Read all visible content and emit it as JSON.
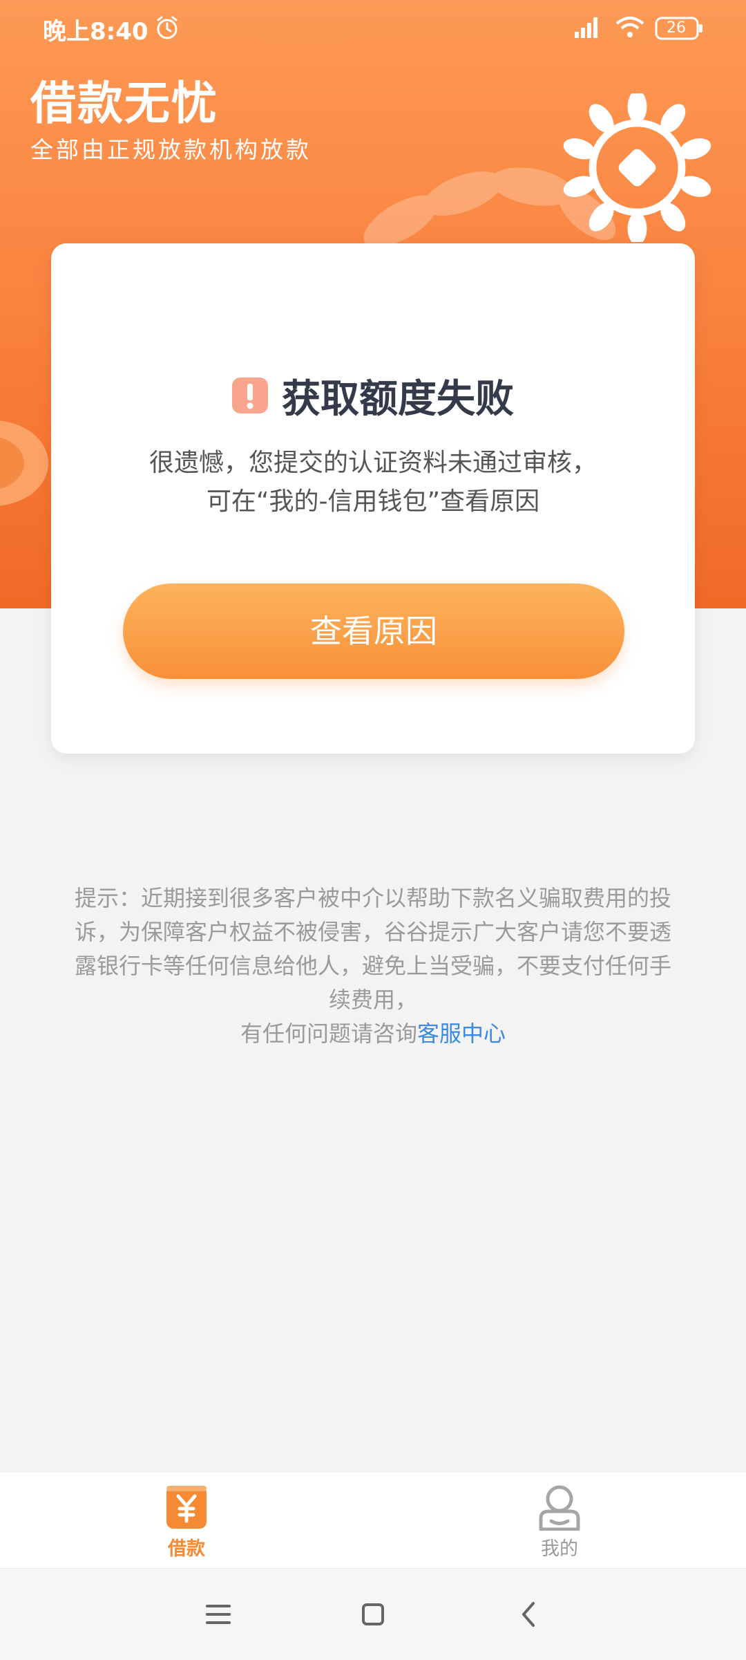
{
  "status_bar": {
    "time": "晚上8:40",
    "battery": "26",
    "icons": [
      "alarm-icon",
      "signal-icon",
      "wifi-icon",
      "battery-icon"
    ]
  },
  "header": {
    "title": "借款无忧",
    "subtitle": "全部由正规放款机构放款"
  },
  "card": {
    "title": "获取额度失败",
    "message_line1": "很遗憾，您提交的认证资料未通过审核，",
    "message_line2": "可在“我的-信用钱包”查看原因",
    "button_label": "查看原因"
  },
  "notice": {
    "text": "提示：近期接到很多客户被中介以帮助下款名义骗取费用的投诉，为保障客户权益不被侵害，谷谷提示广大客户请您不要透露银行卡等任何信息给他人，避免上当受骗，不要支付任何手续费用，",
    "contact_prefix": "有任何问题请咨询",
    "contact_link": "客服中心"
  },
  "tabs": [
    {
      "label": "借款",
      "icon": "yuan-wallet-icon",
      "active": true
    },
    {
      "label": "我的",
      "icon": "user-icon",
      "active": false
    }
  ],
  "colors": {
    "accent": "#f7913a",
    "link": "#3c8ae0",
    "title": "#333a4a"
  }
}
